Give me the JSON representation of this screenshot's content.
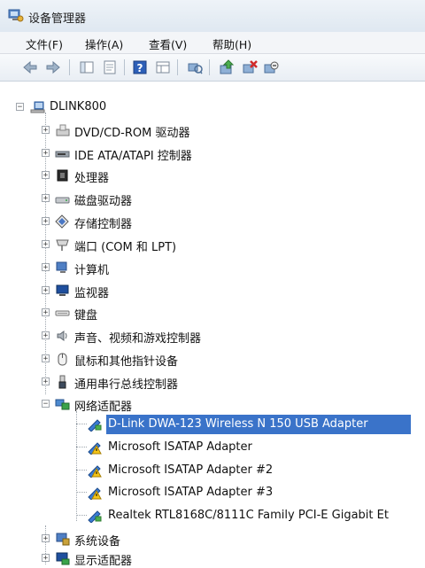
{
  "window": {
    "title": "设备管理器"
  },
  "menu": [
    {
      "id": "file",
      "label": "文件(F)"
    },
    {
      "id": "action",
      "label": "操作(A)"
    },
    {
      "id": "view",
      "label": "查看(V)"
    },
    {
      "id": "help",
      "label": "帮助(H)"
    }
  ],
  "toolbar": {
    "buttons": [
      "back-icon",
      "forward-icon",
      "console-tree-icon",
      "properties-icon",
      "help-icon",
      "view-icon",
      "scan-hardware-icon",
      "update-driver-icon",
      "uninstall-icon",
      "disable-icon"
    ]
  },
  "tree": {
    "root": {
      "label": "DLINK800",
      "icon": "computer-icon"
    },
    "categories": [
      {
        "label": "DVD/CD-ROM 驱动器",
        "icon": "dvd-drive-icon",
        "expanded": false
      },
      {
        "label": "IDE ATA/ATAPI 控制器",
        "icon": "ide-controller-icon",
        "expanded": false
      },
      {
        "label": "处理器",
        "icon": "processor-icon",
        "expanded": false
      },
      {
        "label": "磁盘驱动器",
        "icon": "disk-drive-icon",
        "expanded": false
      },
      {
        "label": "存储控制器",
        "icon": "storage-controller-icon",
        "expanded": false
      },
      {
        "label": "端口 (COM 和 LPT)",
        "icon": "port-icon",
        "expanded": false
      },
      {
        "label": "计算机",
        "icon": "computer-category-icon",
        "expanded": false
      },
      {
        "label": "监视器",
        "icon": "monitor-icon",
        "expanded": false
      },
      {
        "label": "键盘",
        "icon": "keyboard-icon",
        "expanded": false
      },
      {
        "label": "声音、视频和游戏控制器",
        "icon": "sound-icon",
        "expanded": false
      },
      {
        "label": "鼠标和其他指针设备",
        "icon": "mouse-icon",
        "expanded": false
      },
      {
        "label": "通用串行总线控制器",
        "icon": "usb-icon",
        "expanded": false
      },
      {
        "label": "网络适配器",
        "icon": "network-adapter-icon",
        "expanded": true
      }
    ],
    "network_devices": [
      {
        "label": "D-Link DWA-123 Wireless N 150 USB Adapter",
        "selected": true
      },
      {
        "label": "Microsoft ISATAP Adapter",
        "selected": false
      },
      {
        "label": "Microsoft ISATAP Adapter #2",
        "selected": false
      },
      {
        "label": "Microsoft ISATAP Adapter #3",
        "selected": false
      },
      {
        "label": "Realtek RTL8168C/8111C Family PCI-E Gigabit Et",
        "selected": false
      }
    ],
    "after_categories": [
      {
        "label": "系统设备",
        "icon": "system-devices-icon",
        "expanded": false
      },
      {
        "label": "显示适配器",
        "icon": "display-adapter-icon",
        "expanded": false
      }
    ]
  },
  "colors": {
    "selection": "#3a73c9",
    "selection_text": "#ffffff"
  }
}
